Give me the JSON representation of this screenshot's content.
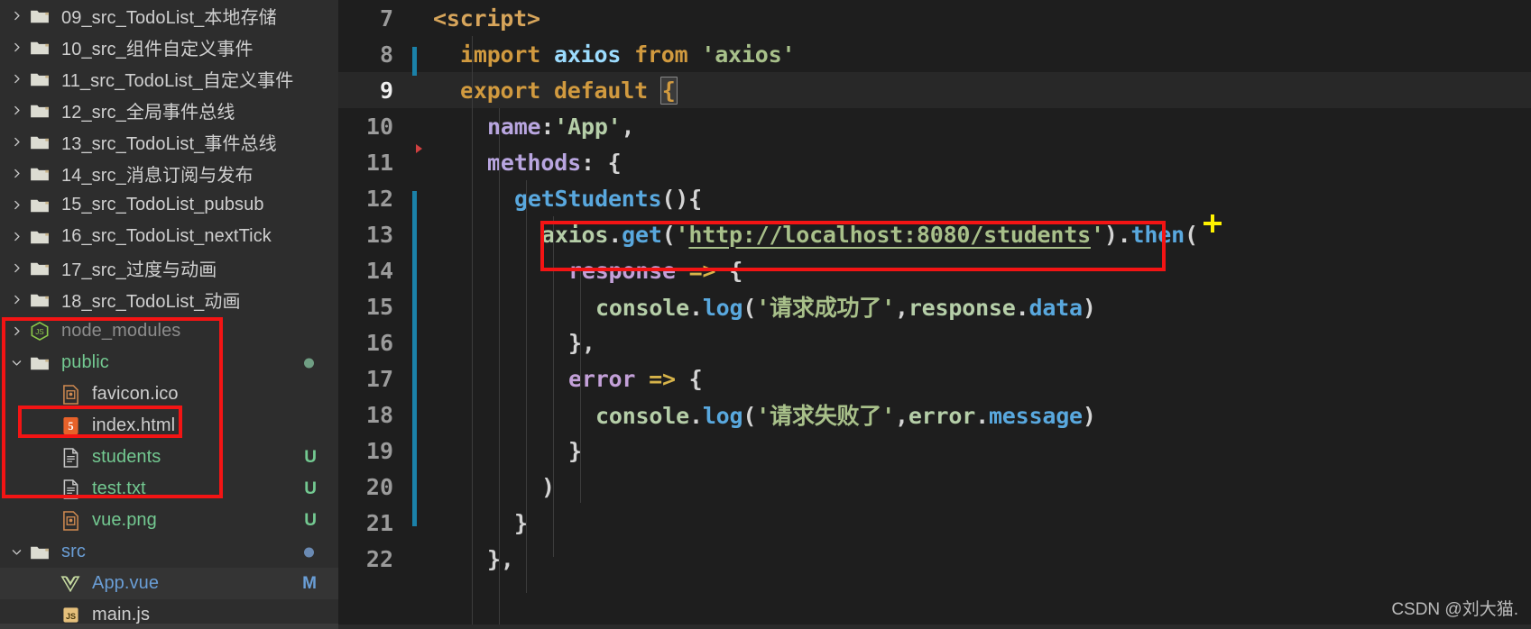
{
  "sidebar": {
    "name": "explorer-file-tree",
    "items": [
      {
        "label": "09_src_TodoList_本地存储",
        "type": "folder",
        "expanded": false,
        "color": "normal",
        "badge": "",
        "dot": ""
      },
      {
        "label": "10_src_组件自定义事件",
        "type": "folder",
        "expanded": false,
        "color": "normal",
        "badge": "",
        "dot": ""
      },
      {
        "label": "11_src_TodoList_自定义事件",
        "type": "folder",
        "expanded": false,
        "color": "normal",
        "badge": "",
        "dot": ""
      },
      {
        "label": "12_src_全局事件总线",
        "type": "folder",
        "expanded": false,
        "color": "normal",
        "badge": "",
        "dot": ""
      },
      {
        "label": "13_src_TodoList_事件总线",
        "type": "folder",
        "expanded": false,
        "color": "normal",
        "badge": "",
        "dot": ""
      },
      {
        "label": "14_src_消息订阅与发布",
        "type": "folder",
        "expanded": false,
        "color": "normal",
        "badge": "",
        "dot": ""
      },
      {
        "label": "15_src_TodoList_pubsub",
        "type": "folder",
        "expanded": false,
        "color": "normal",
        "badge": "",
        "dot": ""
      },
      {
        "label": "16_src_TodoList_nextTick",
        "type": "folder",
        "expanded": false,
        "color": "normal",
        "badge": "",
        "dot": ""
      },
      {
        "label": "17_src_过度与动画",
        "type": "folder",
        "expanded": false,
        "color": "normal",
        "badge": "",
        "dot": ""
      },
      {
        "label": "18_src_TodoList_动画",
        "type": "folder",
        "expanded": false,
        "color": "normal",
        "badge": "",
        "dot": ""
      },
      {
        "label": "node_modules",
        "type": "nodejs",
        "expanded": false,
        "color": "dim",
        "badge": "",
        "dot": ""
      },
      {
        "label": "public",
        "type": "folder",
        "expanded": true,
        "color": "green",
        "badge": "",
        "dot": "green"
      },
      {
        "label": "favicon.ico",
        "type": "image",
        "expanded": null,
        "color": "normal",
        "badge": "",
        "dot": "",
        "indent": 1
      },
      {
        "label": "index.html",
        "type": "html",
        "expanded": null,
        "color": "normal",
        "badge": "",
        "dot": "",
        "indent": 1
      },
      {
        "label": "students",
        "type": "file",
        "expanded": null,
        "color": "green",
        "badge": "U",
        "indent": 1
      },
      {
        "label": "test.txt",
        "type": "file",
        "expanded": null,
        "color": "green",
        "badge": "U",
        "indent": 1
      },
      {
        "label": "vue.png",
        "type": "image",
        "expanded": null,
        "color": "green",
        "badge": "U",
        "indent": 1
      },
      {
        "label": "src",
        "type": "folder",
        "expanded": true,
        "color": "blue",
        "badge": "",
        "dot": "blue"
      },
      {
        "label": "App.vue",
        "type": "vue",
        "expanded": null,
        "color": "blue",
        "badge": "M",
        "indent": 1,
        "selected": true
      },
      {
        "label": "main.js",
        "type": "js",
        "expanded": null,
        "color": "normal",
        "badge": "",
        "indent": 1
      }
    ]
  },
  "editor": {
    "name": "code-editor",
    "active_line": 9,
    "lines": [
      {
        "num": "7",
        "tokens": [
          {
            "t": "<script>",
            "c": "t-tag"
          }
        ],
        "indent": 0
      },
      {
        "num": "8",
        "tokens": [
          {
            "t": "import ",
            "c": "t-kw"
          },
          {
            "t": "axios",
            "c": "t-var"
          },
          {
            "t": " from ",
            "c": "t-kw"
          },
          {
            "t": "'axios'",
            "c": "t-str"
          }
        ],
        "indent": 1
      },
      {
        "num": "9",
        "tokens": [
          {
            "t": "export default ",
            "c": "t-kw"
          },
          {
            "t": "{",
            "c": "bracket"
          }
        ],
        "indent": 1
      },
      {
        "num": "10",
        "tokens": [
          {
            "t": "name",
            "c": "t-prop"
          },
          {
            "t": ":",
            "c": "t-punct"
          },
          {
            "t": "'App'",
            "c": "t-obj"
          },
          {
            "t": ",",
            "c": "t-punct"
          }
        ],
        "indent": 2
      },
      {
        "num": "11",
        "tokens": [
          {
            "t": "methods",
            "c": "t-prop"
          },
          {
            "t": ": {",
            "c": "t-punct"
          }
        ],
        "indent": 2
      },
      {
        "num": "12",
        "tokens": [
          {
            "t": "getStudents",
            "c": "t-fn"
          },
          {
            "t": "(){",
            "c": "t-punct"
          }
        ],
        "indent": 3
      },
      {
        "num": "13",
        "tokens": [
          {
            "t": "axios",
            "c": "t-obj"
          },
          {
            "t": ".",
            "c": "t-punct"
          },
          {
            "t": "get",
            "c": "t-member"
          },
          {
            "t": "(",
            "c": "t-punct"
          },
          {
            "t": "'",
            "c": "t-str"
          },
          {
            "t": "http://localhost:8080/students",
            "c": "t-link"
          },
          {
            "t": "'",
            "c": "t-str"
          },
          {
            "t": ")",
            "c": "t-punct"
          },
          {
            "t": ".",
            "c": "t-punct"
          },
          {
            "t": "then",
            "c": "t-member"
          },
          {
            "t": "(",
            "c": "t-punct"
          }
        ],
        "indent": 4
      },
      {
        "num": "14",
        "tokens": [
          {
            "t": "response ",
            "c": "t-param"
          },
          {
            "t": "=>",
            "c": "t-arrow"
          },
          {
            "t": " {",
            "c": "t-punct"
          }
        ],
        "indent": 5
      },
      {
        "num": "15",
        "tokens": [
          {
            "t": "console",
            "c": "t-obj"
          },
          {
            "t": ".",
            "c": "t-punct"
          },
          {
            "t": "log",
            "c": "t-member"
          },
          {
            "t": "(",
            "c": "t-punct"
          },
          {
            "t": "'请求成功了'",
            "c": "t-str"
          },
          {
            "t": ",",
            "c": "t-punct"
          },
          {
            "t": "response",
            "c": "t-obj"
          },
          {
            "t": ".",
            "c": "t-punct"
          },
          {
            "t": "data",
            "c": "t-member"
          },
          {
            "t": ")",
            "c": "t-punct"
          }
        ],
        "indent": 6
      },
      {
        "num": "16",
        "tokens": [
          {
            "t": "},",
            "c": "t-punct"
          }
        ],
        "indent": 5
      },
      {
        "num": "17",
        "tokens": [
          {
            "t": "error ",
            "c": "t-param"
          },
          {
            "t": "=>",
            "c": "t-arrow"
          },
          {
            "t": " {",
            "c": "t-punct"
          }
        ],
        "indent": 5
      },
      {
        "num": "18",
        "tokens": [
          {
            "t": "console",
            "c": "t-obj"
          },
          {
            "t": ".",
            "c": "t-punct"
          },
          {
            "t": "log",
            "c": "t-member"
          },
          {
            "t": "(",
            "c": "t-punct"
          },
          {
            "t": "'请求失败了'",
            "c": "t-str"
          },
          {
            "t": ",",
            "c": "t-punct"
          },
          {
            "t": "error",
            "c": "t-obj"
          },
          {
            "t": ".",
            "c": "t-punct"
          },
          {
            "t": "message",
            "c": "t-member"
          },
          {
            "t": ")",
            "c": "t-punct"
          }
        ],
        "indent": 6
      },
      {
        "num": "19",
        "tokens": [
          {
            "t": "}",
            "c": "t-punct"
          }
        ],
        "indent": 5
      },
      {
        "num": "20",
        "tokens": [
          {
            "t": ")",
            "c": "t-punct"
          }
        ],
        "indent": 4
      },
      {
        "num": "21",
        "tokens": [
          {
            "t": "}",
            "c": "t-punct"
          }
        ],
        "indent": 3
      },
      {
        "num": "22",
        "tokens": [
          {
            "t": "},",
            "c": "t-punct"
          }
        ],
        "indent": 2
      }
    ]
  },
  "annotations": {
    "box_color": "#f31414",
    "cursor_color": "#fff200",
    "cursor_label": "crosshair-cursor"
  },
  "watermark": {
    "text": "CSDN @刘大猫."
  }
}
